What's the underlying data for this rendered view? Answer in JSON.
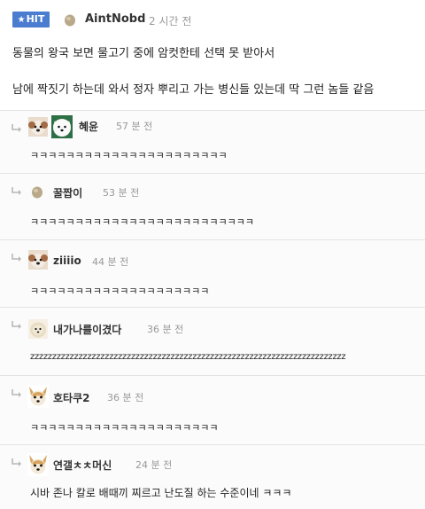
{
  "post": {
    "badge": "HIT",
    "author": "AintNobd",
    "time": "2 시간 전",
    "lines": [
      "동물의 왕국 보면 물고기 중에 암컷한테 선택 못 받아서",
      "남에 짝짓기 하는데 와서 정자 뿌리고 가는 병신들 있는데 딱 그런 놈들 같음"
    ]
  },
  "comments": [
    {
      "author": "혜윤",
      "time": "57 분 전",
      "text": "ㅋㅋㅋㅋㅋㅋㅋㅋㅋㅋㅋㅋㅋㅋㅋㅋㅋㅋㅋㅋㅋㅋ"
    },
    {
      "author": "꿀짭이",
      "time": "53 분 전",
      "text": "ㅋㅋㅋㅋㅋㅋㅋㅋㅋㅋㅋㅋㅋㅋㅋㅋㅋㅋㅋㅋㅋㅋㅋㅋㅋ"
    },
    {
      "author": "ziiiio",
      "time": "44 분 전",
      "text": "ㅋㅋㅋㅋㅋㅋㅋㅋㅋㅋㅋㅋㅋㅋㅋㅋㅋㅋㅋㅋ"
    },
    {
      "author": "내가나를이겼다",
      "time": "36 분 전",
      "text": "zzzzzzzzzzzzzzzzzzzzzzzzzzzzzzzzzzzzzzzzzzzzzzzzzzzzzzzzzzzzzzzzzzzzzzzz"
    },
    {
      "author": "호타쿠2",
      "time": "36 분 전",
      "text": "ㅋㅋㅋㅋㅋㅋㅋㅋㅋㅋㅋㅋㅋㅋㅋㅋㅋㅋㅋㅋㅋ"
    },
    {
      "author": "연갤ㅊㅊ머신",
      "time": "24 분 전",
      "text": "시바 존나 칼로 배때끼 찌르고 난도질 하는 수준이네 ㅋㅋㅋ"
    }
  ]
}
